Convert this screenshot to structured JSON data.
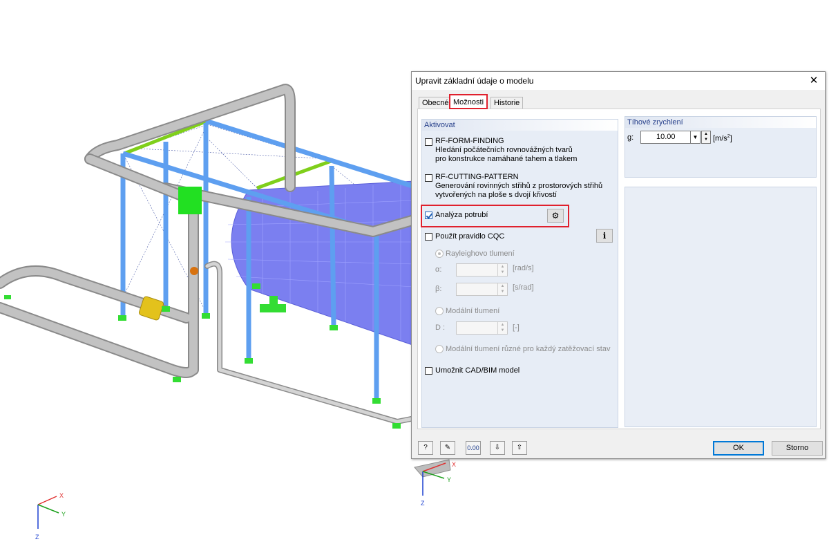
{
  "axes_main": {
    "x": "X",
    "y": "Y",
    "z": "Z"
  },
  "axes_small": {
    "x": "X",
    "y": "Y",
    "z": "Z"
  },
  "dialog": {
    "title": "Upravit základní údaje o modelu",
    "close_icon": "close-icon",
    "tabs": [
      {
        "label": "Obecné",
        "active": false
      },
      {
        "label": "Možnosti",
        "active": true
      },
      {
        "label": "Historie",
        "active": false
      }
    ],
    "activate_group": {
      "title": "Aktivovat",
      "form_finding": {
        "label": "RF-FORM-FINDING",
        "desc1": "Hledání počátečních rovnovážných tvarů",
        "desc2": "pro konstrukce namáhané tahem a tlakem",
        "checked": false
      },
      "cutting_pattern": {
        "label": "RF-CUTTING-PATTERN",
        "desc1": "Generování rovinných střihů z prostorových střihů",
        "desc2": "vytvořených na ploše s dvojí křivostí",
        "checked": false
      },
      "pipe_analysis": {
        "label": "Analýza potrubí",
        "checked": true,
        "settings_icon": "pipe-settings-icon"
      },
      "cqc": {
        "label": "Použít pravidlo CQC",
        "checked": false,
        "info_icon": "info-icon"
      },
      "rayleigh": {
        "label": "Rayleighovo tlumení",
        "alpha": "α:",
        "alpha_unit": "[rad/s]",
        "beta": "β:",
        "beta_unit": "[s/rad]"
      },
      "modal": {
        "label": "Modální tlumení",
        "d": "D :",
        "d_unit": "[-]"
      },
      "modal_per_case": {
        "label": "Modální tlumení různé pro každý zatěžovací stav"
      },
      "cad_bim": {
        "label": "Umožnit CAD/BIM model",
        "checked": false
      }
    },
    "gravity_group": {
      "title": "Tíhové zrychlení",
      "g_label": "g:",
      "g_value": "10.00",
      "g_unit": "[m/s",
      "g_unit_sup": "2",
      "g_unit_end": "]"
    },
    "toolbar": {
      "help_icon": "help-icon",
      "edit_icon": "edit-icon",
      "units_label": "0.00",
      "import_icon": "import-icon",
      "export_icon": "export-icon"
    },
    "ok_label": "OK",
    "cancel_label": "Storno"
  }
}
